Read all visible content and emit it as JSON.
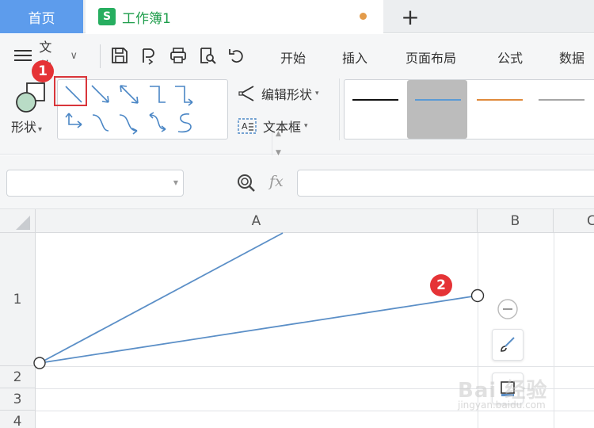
{
  "tabs": {
    "home_label": "首页",
    "doc_icon_letter": "S",
    "doc_title": "工作簿1",
    "add_label": "+"
  },
  "ribbon": {
    "menu_label": "文件",
    "menu_chevron": "∨",
    "tabs": [
      "开始",
      "插入",
      "页面布局",
      "公式",
      "数据"
    ],
    "shapes_label": "形状",
    "shapes_chevron": "▾",
    "edit_shape_label": "编辑形状",
    "textbox_label": "文本框",
    "dropdown_chevron": "▾",
    "line_styles": [
      "#111111",
      "#5b9bd5",
      "#e08a3c",
      "#a6a6a6"
    ]
  },
  "annotations": {
    "step1": "1",
    "step2": "2"
  },
  "formula_bar": {
    "namebox_value": "",
    "fx_label": "fx",
    "formula_value": ""
  },
  "grid": {
    "columns": [
      "A",
      "B",
      "C"
    ],
    "rows": [
      "1",
      "2",
      "3",
      "4"
    ]
  },
  "colors": {
    "accent": "#5d9cec",
    "line_color": "#5b8fc7",
    "badge_red": "#e53336"
  },
  "watermark": {
    "main": "Bai 经验",
    "sub": "jingyan.baidu.com"
  }
}
